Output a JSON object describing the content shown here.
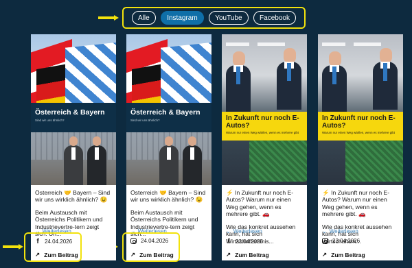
{
  "filters": [
    {
      "label": "Alle",
      "active": false
    },
    {
      "label": "Instagram",
      "active": true
    },
    {
      "label": "YouTube",
      "active": false
    },
    {
      "label": "Facebook",
      "active": false
    }
  ],
  "cards": [
    {
      "image_title": "Österreich & Bayern",
      "image_subtitle": "Sind wir uns ähnlich?",
      "text_1": "Österreich 🤝 Bayern – Sind wir uns wirklich ähnlich? 😉",
      "text_2": "Beim Austausch mit Österreichs Politikern und Industrievertre-tern zeigt sich: Un...",
      "more": "Weiterlesen",
      "platform": "facebook",
      "date": "24.04.2026",
      "link": "Zum Beitrag"
    },
    {
      "image_title": "Österreich & Bayern",
      "image_subtitle": "Sind wir uns ähnlich?",
      "text_1": "Österreich 🤝 Bayern – Sind wir uns wirklich ähnlich? 😉",
      "text_2": "Beim Austausch mit Österreichs Politikern und Industrievertre-tern zeigt sich...",
      "more": "Weiterlesen",
      "platform": "instagram",
      "date": "24.04.2026",
      "link": "Zum Beitrag"
    },
    {
      "image_title": "In Zukunft nur noch E-Autos?",
      "image_subtitle": "Warum nur einen Weg wählen, wenn es mehrere gibt",
      "text_1": "⚡ In Zukunft nur noch E-Autos? Warum nur einen Weg gehen, wenn es mehrere gibt. 🚗",
      "text_2": "Wie das konkret aussehen kann, hat sich Wirtschaftsminis...",
      "more": "Weiterlesen",
      "platform": "facebook",
      "date": "23.04.2026",
      "link": "Zum Beitrag"
    },
    {
      "image_title": "In Zukunft nur noch E-Autos?",
      "image_subtitle": "Warum nur einen Weg wählen, wenn es mehrere gibt",
      "text_1": "⚡ In Zukunft nur noch E-Autos? Warum nur einen Weg gehen, wenn es mehrere gibt. 🚗",
      "text_2": "Wie das konkret aussehen kann, hat sich Wirtschaftsm...",
      "more": "Weiterlesen",
      "platform": "instagram",
      "date": "23.04.2026",
      "link": "Zum Beitrag"
    }
  ],
  "colors": {
    "background": "#0d2a3f",
    "highlight": "#f2e20c",
    "active_pill": "#0f6fa8",
    "link_blue": "#3a7fb5"
  },
  "icons": [
    "facebook-icon",
    "instagram-icon",
    "chevron-down-icon",
    "arrow-up-right-icon"
  ]
}
